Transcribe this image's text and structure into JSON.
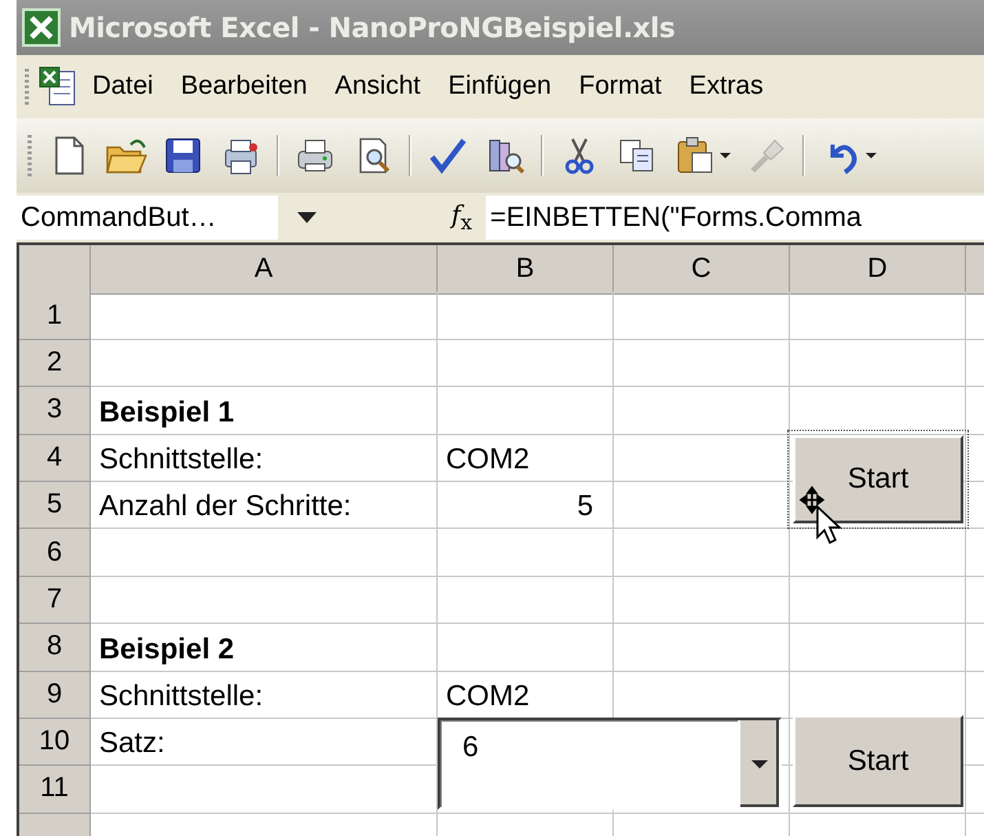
{
  "window": {
    "title": "Microsoft Excel - NanoProNGBeispiel.xls"
  },
  "menu": [
    {
      "label": "Datei"
    },
    {
      "label": "Bearbeiten"
    },
    {
      "label": "Ansicht"
    },
    {
      "label": "Einfügen"
    },
    {
      "label": "Format"
    },
    {
      "label": "Extras"
    }
  ],
  "toolbar": [
    [
      {
        "kind": "new",
        "disabled": false
      },
      {
        "kind": "open",
        "disabled": false
      },
      {
        "kind": "save",
        "disabled": false
      },
      {
        "kind": "permission",
        "disabled": false
      }
    ],
    [
      {
        "kind": "print",
        "disabled": false
      },
      {
        "kind": "preview",
        "disabled": false
      }
    ],
    [
      {
        "kind": "spelling",
        "disabled": false
      },
      {
        "kind": "research",
        "disabled": false
      }
    ],
    [
      {
        "kind": "cut",
        "disabled": false
      },
      {
        "kind": "copy",
        "disabled": false
      },
      {
        "kind": "paste",
        "disabled": false
      },
      {
        "kind": "dropdown",
        "disabled": false
      },
      {
        "kind": "painter",
        "disabled": true
      }
    ],
    [
      {
        "kind": "undo",
        "disabled": false
      },
      {
        "kind": "dropdown",
        "disabled": false
      }
    ]
  ],
  "name_box": {
    "value": "CommandBut…"
  },
  "insert_function": {
    "label": "*f*$_{x}$"
  },
  "formula": {
    "value": "=EINBETTEN(\"Forms.Comma"
  },
  "sheet": {
    "columns": [
      {
        "label": "A"
      },
      {
        "label": "B"
      },
      {
        "label": "C"
      },
      {
        "label": "D"
      }
    ],
    "rows": [
      {
        "label": "1",
        "cells": {}
      },
      {
        "label": "2",
        "cells": {}
      },
      {
        "label": "3",
        "cells": {
          "A": {
            "text": "Beispiel 1",
            "bold": true,
            "numeric": false
          }
        }
      },
      {
        "label": "4",
        "cells": {
          "A": {
            "text": "Schnittstelle:",
            "bold": false,
            "numeric": false
          },
          "B": {
            "text": "COM2",
            "bold": false,
            "numeric": false
          }
        }
      },
      {
        "label": "5",
        "cells": {
          "A": {
            "text": "Anzahl der Schritte:",
            "bold": false,
            "numeric": false
          },
          "B": {
            "text": "5",
            "bold": false,
            "numeric": true
          }
        }
      },
      {
        "label": "6",
        "cells": {}
      },
      {
        "label": "7",
        "cells": {}
      },
      {
        "label": "8",
        "cells": {
          "A": {
            "text": "Beispiel 2",
            "bold": true,
            "numeric": false
          }
        }
      },
      {
        "label": "9",
        "cells": {
          "A": {
            "text": "Schnittstelle:",
            "bold": false,
            "numeric": false
          },
          "B": {
            "text": "COM2",
            "bold": false,
            "numeric": false
          }
        }
      },
      {
        "label": "10",
        "cells": {
          "A": {
            "text": "Satz:",
            "bold": false,
            "numeric": false
          }
        }
      },
      {
        "label": "11",
        "cells": {}
      }
    ]
  },
  "controls": [
    {
      "kind": "button",
      "label": "Start",
      "selected": true
    },
    {
      "kind": "combobox",
      "value": "6",
      "selected": false
    },
    {
      "kind": "button",
      "label": "Start",
      "selected": false
    }
  ]
}
